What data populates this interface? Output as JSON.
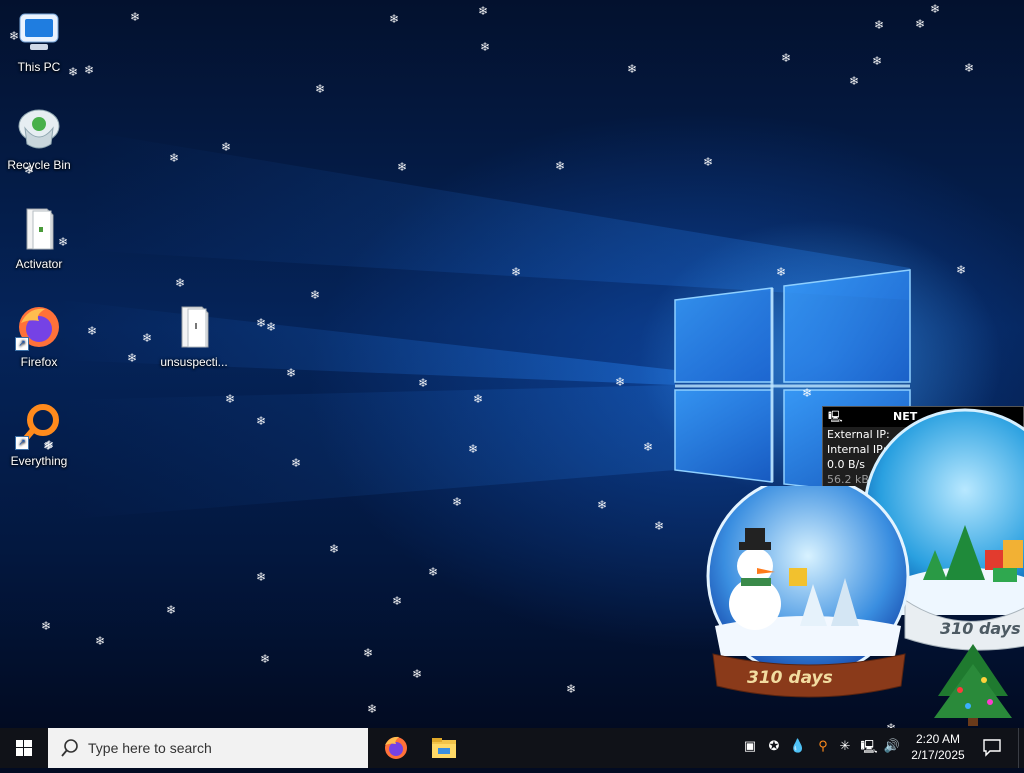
{
  "desktop": {
    "icons": [
      {
        "label": "This PC",
        "icon": "monitor-icon"
      },
      {
        "label": "Recycle Bin",
        "icon": "recycle-bin-icon"
      },
      {
        "label": "Activator",
        "icon": "document-icon"
      },
      {
        "label": "Firefox",
        "icon": "firefox-icon"
      },
      {
        "label": "Everything",
        "icon": "everything-search-icon"
      },
      {
        "label": "unsuspecti...",
        "icon": "document-icon"
      }
    ]
  },
  "net_widget": {
    "title": "NET",
    "external_ip_label": "External IP:",
    "internal_ip_label": "Internal IP:",
    "speed_upload": "0.0 B/s",
    "speed_download": "56.2 kB/s"
  },
  "snow_globes": [
    {
      "days_label": "310 days",
      "scene": "snowman"
    },
    {
      "days_label": "310 days",
      "scene": "christmas-tree-presents"
    }
  ],
  "taskbar": {
    "search_placeholder": "Type here to search",
    "pinned": [
      "firefox-icon",
      "file-explorer-icon"
    ],
    "tray_icons": [
      "security-icon",
      "network-people-icon",
      "droplet-icon",
      "search-tray-icon",
      "snowflake-icon",
      "network-icon",
      "volume-icon"
    ],
    "clock": {
      "time": "2:20 AM",
      "date": "2/17/2025"
    }
  },
  "colors": {
    "taskbar": "#101218",
    "search_box": "#f2f2f2",
    "windows_blue": "#1e7be8",
    "snow": "#ffffff"
  }
}
